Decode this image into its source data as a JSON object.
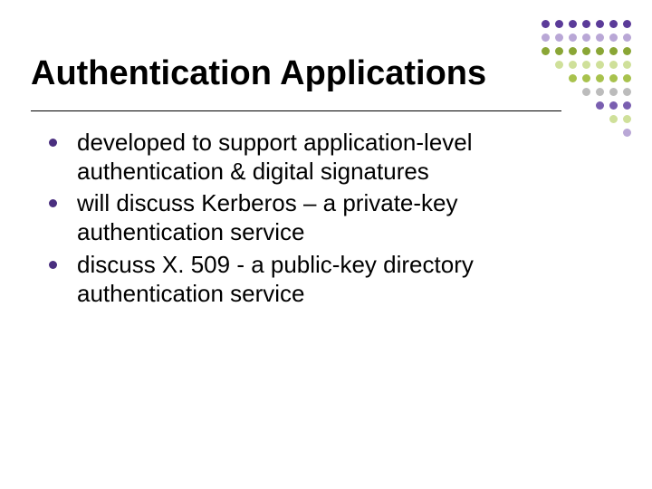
{
  "slide": {
    "title": "Authentication Applications",
    "bullets": [
      "developed to support application-level authentication & digital signatures",
      "will discuss Kerberos – a private-key authentication service",
      "discuss X. 509 - a public-key directory authentication service"
    ]
  },
  "decor": {
    "grid": [
      [
        "c-pd",
        "c-pd",
        "c-pd",
        "c-pd",
        "c-pd",
        "c-pd",
        "c-pd"
      ],
      [
        "c-pl",
        "c-pl",
        "c-pl",
        "c-pl",
        "c-pl",
        "c-pl",
        "c-pl"
      ],
      [
        "c-gd",
        "c-gd",
        "c-gd",
        "c-gd",
        "c-gd",
        "c-gd",
        "c-gd"
      ],
      [
        "c-em",
        "c-gl",
        "c-gl",
        "c-gl",
        "c-gl",
        "c-gl",
        "c-gl"
      ],
      [
        "c-em",
        "c-em",
        "c-gm",
        "c-gm",
        "c-gm",
        "c-gm",
        "c-gm"
      ],
      [
        "c-em",
        "c-em",
        "c-em",
        "c-gg",
        "c-gg",
        "c-gg",
        "c-gg"
      ],
      [
        "c-em",
        "c-em",
        "c-em",
        "c-em",
        "c-pm",
        "c-pm",
        "c-pm"
      ],
      [
        "c-em",
        "c-em",
        "c-em",
        "c-em",
        "c-em",
        "c-gl",
        "c-gl"
      ],
      [
        "c-em",
        "c-em",
        "c-em",
        "c-em",
        "c-em",
        "c-em",
        "c-pl"
      ]
    ]
  }
}
